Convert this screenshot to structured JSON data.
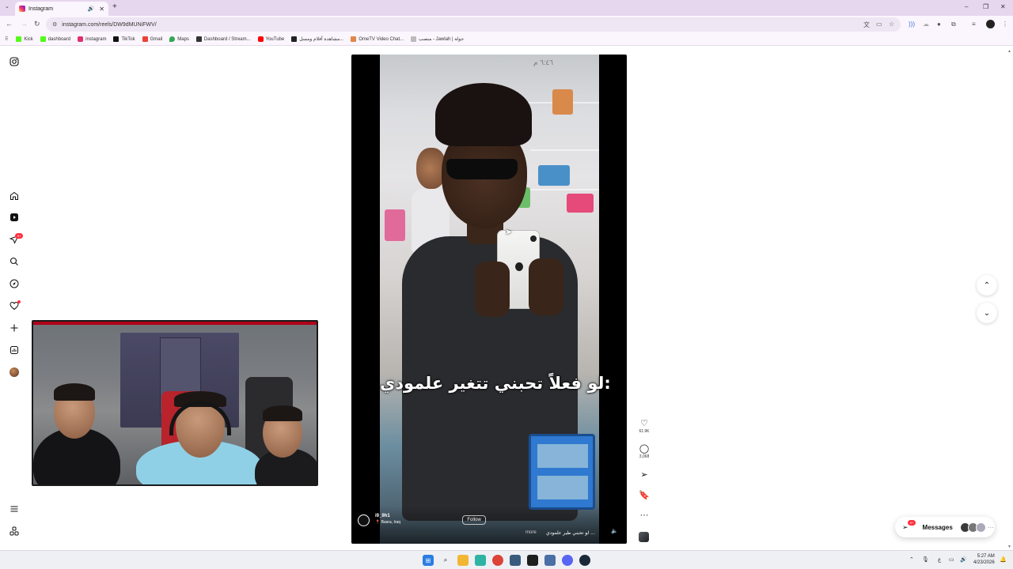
{
  "browser": {
    "tab_title": "Instagram",
    "url": "instagram.com/reels/DW9dMUNiFWV/",
    "bookmarks": [
      {
        "label": "Kick",
        "color": "#53fc18"
      },
      {
        "label": "dashboard",
        "color": "#53fc18"
      },
      {
        "label": "instagram",
        "color": "#e1306c"
      },
      {
        "label": "TikTok",
        "color": "#111111"
      },
      {
        "label": "Gmail",
        "color": "#ea4335"
      },
      {
        "label": "Maps",
        "color": "#34a853"
      },
      {
        "label": "Dashboard / Stream...",
        "color": "#333333"
      },
      {
        "label": "YouTube",
        "color": "#ff0000"
      },
      {
        "label": "مشاهدة أفلام ومسل...",
        "color": "#222222"
      },
      {
        "label": "OmeTV Video Chat...",
        "color": "#e2854a"
      },
      {
        "label": "منصب - Jawlah | جولة",
        "color": "#bbbbbb"
      }
    ]
  },
  "sidebar": {
    "notifications_badge": "9+"
  },
  "reel": {
    "time_overlay": "٦:٤٦ م",
    "caption_overlay": "لو فعلاً تحبني تتغير علمودي:",
    "username": "i9_9h1",
    "location": "Basra, Iraq",
    "follow_label": "Follow",
    "caption": "لو تحبني طير علمودي ...",
    "more_label": "more"
  },
  "actions": {
    "likes": "61.9K",
    "comments": "3,068"
  },
  "messages": {
    "label": "Messages",
    "badge": "9+"
  },
  "taskbar": {
    "time": "5:27 AM",
    "date": "4/23/2026",
    "lang": "ع"
  },
  "colors": {
    "accent_red": "#ff3040",
    "chrome_bg": "#e6d6ee"
  }
}
